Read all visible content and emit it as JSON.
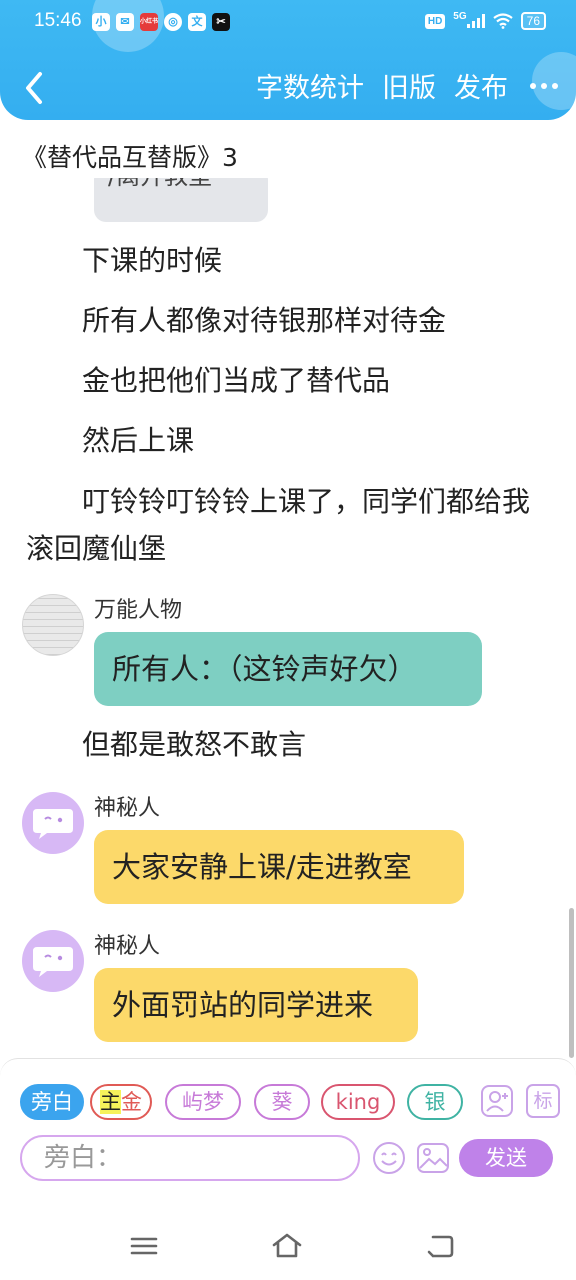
{
  "status": {
    "time": "15:46",
    "apps": [
      "小",
      "✉",
      "小红书",
      "◎",
      "文",
      "✂"
    ],
    "hd": "HD",
    "network": "5G",
    "battery": "76"
  },
  "header": {
    "word_count": "字数统计",
    "old_version": "旧版",
    "publish": "发布"
  },
  "doc_title": "《替代品互替版》3",
  "chat": {
    "partial_bubble_text": "/离开教室",
    "narration": [
      "下课的时候",
      "所有人都像对待银那样对待金",
      "金也把他们当成了替代品",
      "然后上课",
      "叮铃铃叮铃铃上课了，同学们都给我滚回魔仙堡",
      "但都是敢怒不敢言"
    ],
    "messages": [
      {
        "sender": "万能人物",
        "text": "所有人：（这铃声好欠）",
        "color": "#7ecfc2"
      },
      {
        "sender": "神秘人",
        "text": "大家安静上课/走进教室",
        "color": "#fcd96a"
      },
      {
        "sender": "神秘人",
        "text": "外面罚站的同学进来",
        "color": "#fcd96a"
      }
    ]
  },
  "composer": {
    "roles": [
      {
        "label": "旁白",
        "active": true
      },
      {
        "label_hl": "主",
        "label": "金",
        "color": "#e05a55"
      },
      {
        "label": "屿梦",
        "color": "#c77ad8"
      },
      {
        "label": "葵",
        "color": "#c77ad8"
      },
      {
        "label": "king",
        "color": "#d9556f"
      },
      {
        "label": "银",
        "color": "#3fb3a3"
      }
    ],
    "tag_label": "标",
    "placeholder": "旁白：",
    "send_label": "发送"
  },
  "colors": {
    "header_bg": "#34aef0",
    "accent_purple": "#bf82e9",
    "teal_bubble": "#7ecfc2",
    "yellow_bubble": "#fcd96a"
  }
}
